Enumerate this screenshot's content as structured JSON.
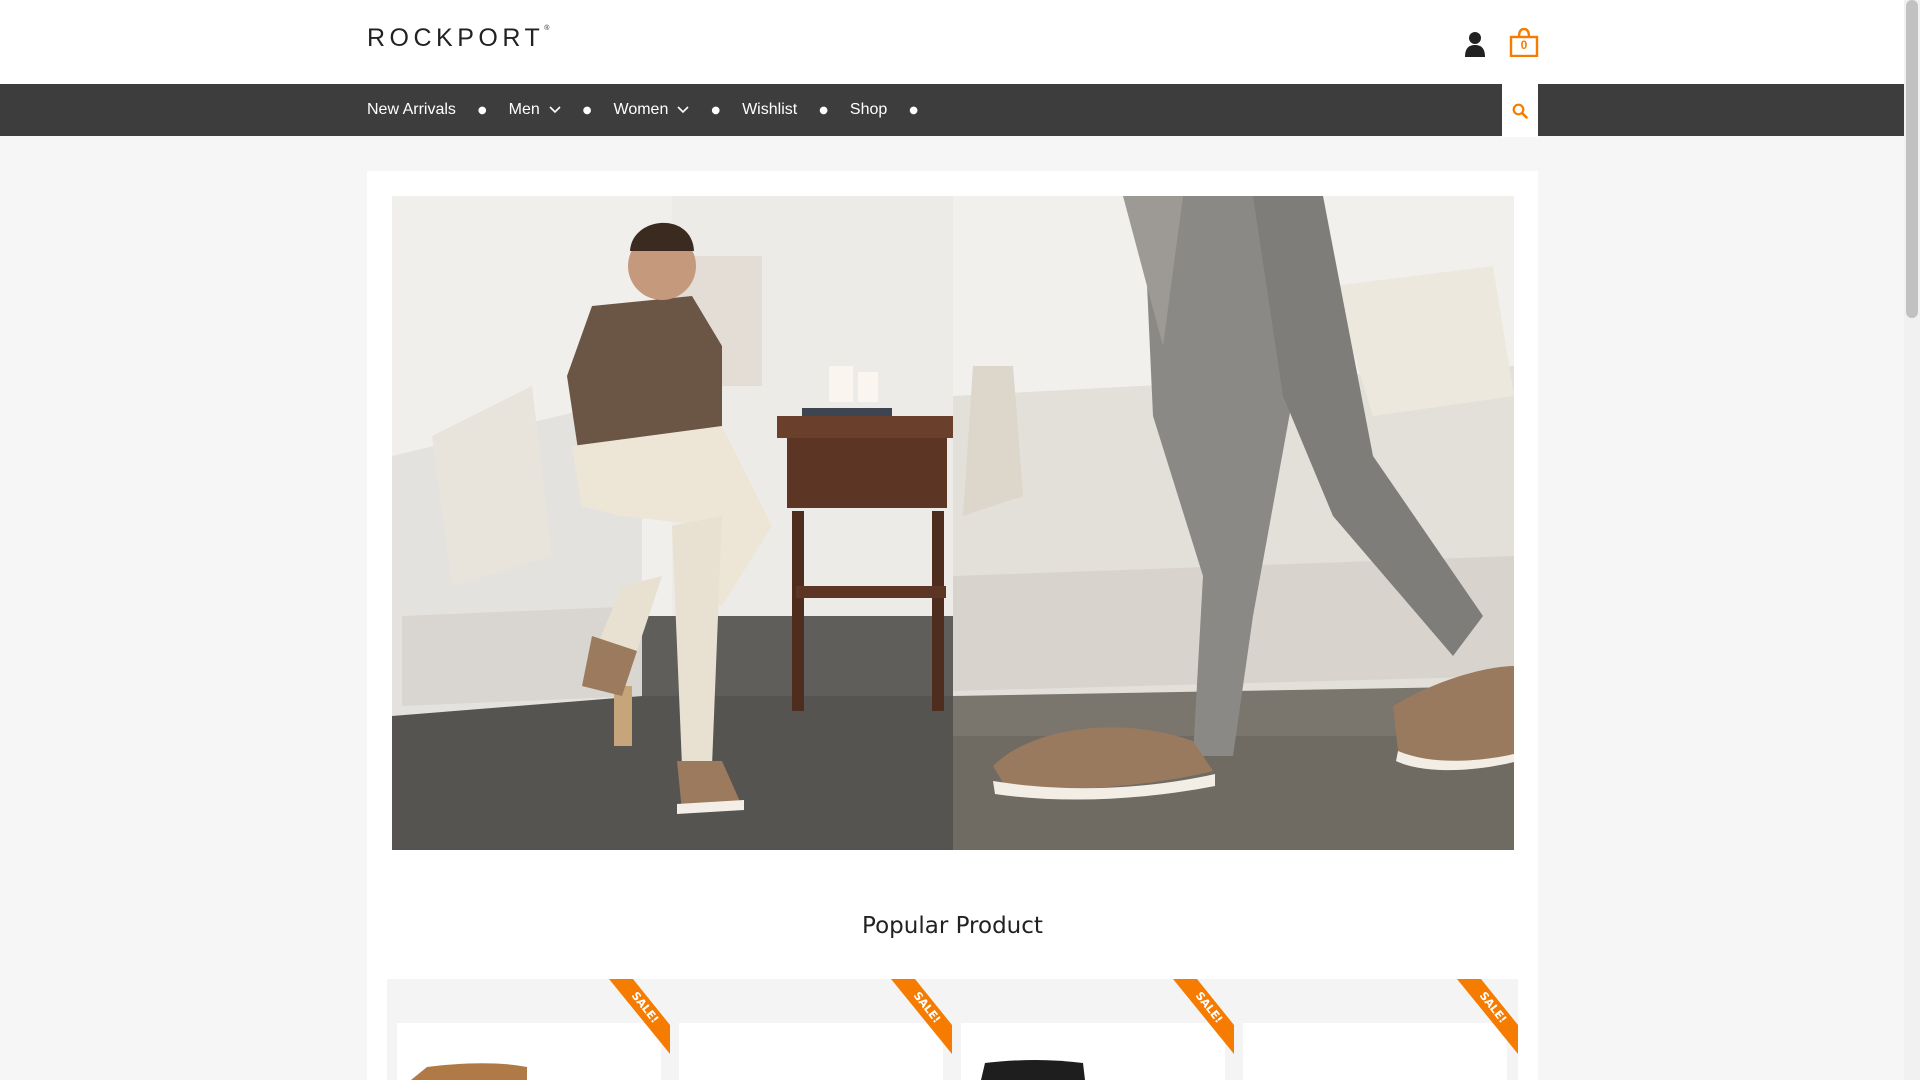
{
  "header": {
    "brand": "ROCKPORT",
    "trademark": "®",
    "cart_count": "0"
  },
  "nav": {
    "items": [
      {
        "label": "New Arrivals",
        "has_dropdown": false
      },
      {
        "label": "Men",
        "has_dropdown": true
      },
      {
        "label": "Women",
        "has_dropdown": true
      },
      {
        "label": "Wishlist",
        "has_dropdown": false
      },
      {
        "label": "Shop",
        "has_dropdown": false
      }
    ]
  },
  "main": {
    "section_title": "Popular Product",
    "sale_badge": "SALE!"
  },
  "colors": {
    "accent": "#f57c00",
    "nav_bg": "#3d3d3d",
    "page_bg": "#f6f6f6"
  },
  "icons": {
    "user": "user-icon",
    "cart": "shopping-bag-icon",
    "search": "search-icon",
    "dropdown": "chevron-down-icon"
  }
}
